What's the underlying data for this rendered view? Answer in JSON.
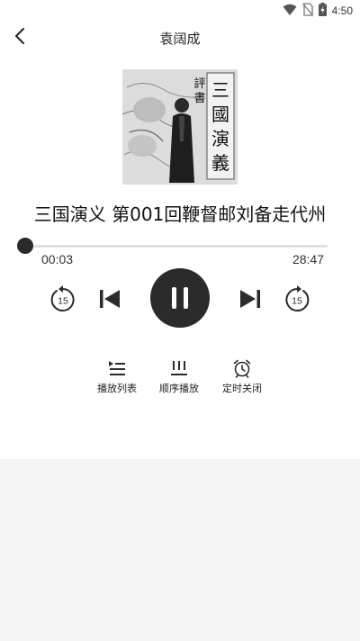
{
  "status_bar": {
    "time": "4:50",
    "icons": [
      "wifi-icon",
      "no-sim-icon",
      "battery-charging-icon"
    ]
  },
  "header": {
    "title": "袁阔成",
    "back_icon": "chevron-left-icon"
  },
  "cover": {
    "text_vertical_main": "三國演義",
    "text_vertical_side": "評書"
  },
  "track": {
    "title": "三国演义 第001回鞭督邮刘备走代州"
  },
  "progress": {
    "current_time": "00:03",
    "total_time": "28:47",
    "fraction": 0.002
  },
  "controls": {
    "rewind_seconds": "15",
    "forward_seconds": "15",
    "state": "playing"
  },
  "options": [
    {
      "label": "播放列表",
      "icon": "playlist-icon"
    },
    {
      "label": "顺序播放",
      "icon": "sequential-play-icon"
    },
    {
      "label": "定时关闭",
      "icon": "alarm-clock-icon"
    }
  ],
  "colors": {
    "accent": "#2b2b2b",
    "background_top": "#ffffff",
    "background_bottom": "#f5f5f5"
  }
}
